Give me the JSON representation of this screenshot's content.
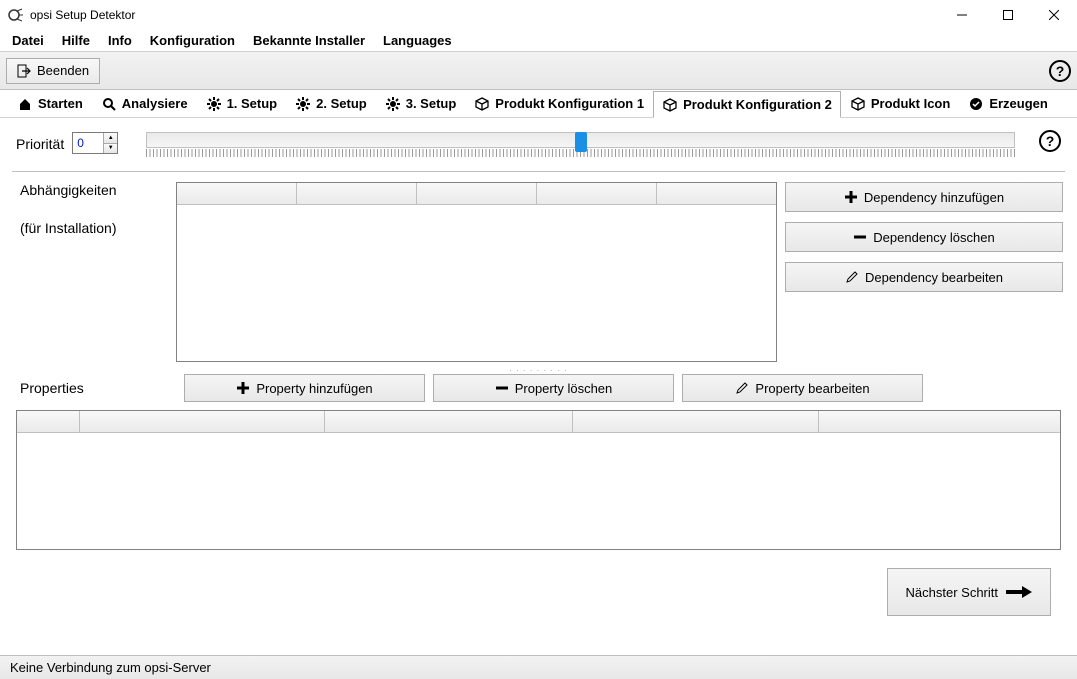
{
  "window": {
    "title": "opsi Setup Detektor"
  },
  "menu": {
    "datei": "Datei",
    "hilfe": "Hilfe",
    "info": "Info",
    "konfiguration": "Konfiguration",
    "bekannte_installer": "Bekannte Installer",
    "languages": "Languages"
  },
  "toolbar": {
    "beenden": "Beenden"
  },
  "tabs": {
    "starten": "Starten",
    "analysiere": "Analysiere",
    "setup1": "1. Setup",
    "setup2": "2. Setup",
    "setup3": "3. Setup",
    "prod_konf1": "Produkt Konfiguration 1",
    "prod_konf2": "Produkt Konfiguration 2",
    "prod_icon": "Produkt Icon",
    "erzeugen": "Erzeugen"
  },
  "priority": {
    "label": "Priorität",
    "value": "0"
  },
  "dependencies": {
    "title": "Abhängigkeiten",
    "subtitle": "(für Installation)",
    "add": "Dependency hinzufügen",
    "remove": "Dependency löschen",
    "edit": "Dependency bearbeiten"
  },
  "properties": {
    "title": "Properties",
    "add": "Property hinzufügen",
    "remove": "Property löschen",
    "edit": "Property bearbeiten"
  },
  "next_button": "Nächster Schritt",
  "status": "Keine Verbindung zum opsi-Server"
}
